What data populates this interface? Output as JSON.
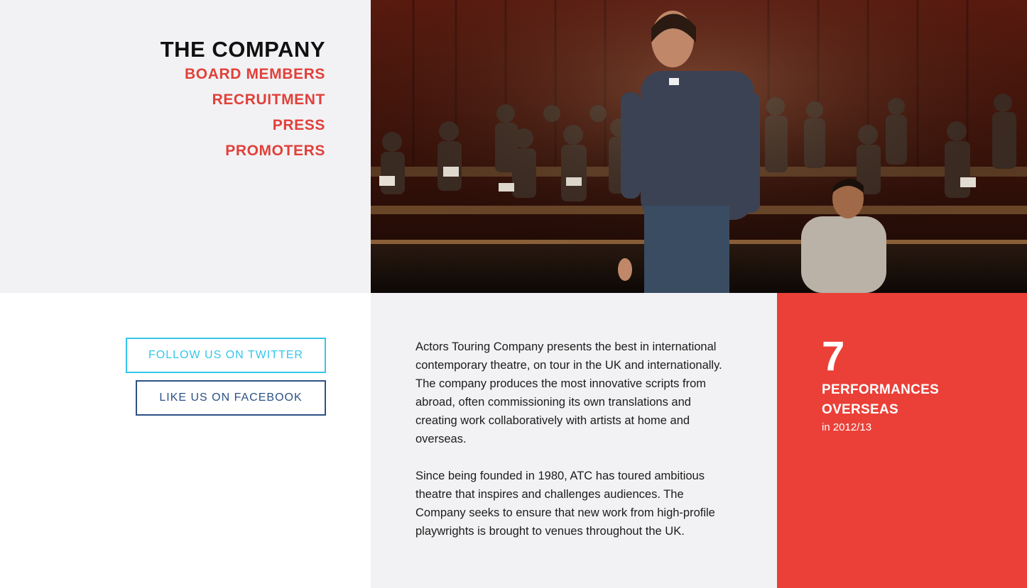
{
  "nav": {
    "title": "THE COMPANY",
    "links": [
      "BOARD MEMBERS",
      "RECRUITMENT",
      "PRESS",
      "PROMOTERS"
    ]
  },
  "hero": {
    "image": "theatre-performance-photo"
  },
  "social": {
    "twitter_label": "FOLLOW US ON TWITTER",
    "facebook_label": "LIKE US ON FACEBOOK"
  },
  "about": {
    "paragraphs": [
      "Actors Touring Company presents the best in international contemporary theatre, on tour in the UK and internationally. The company produces the most innovative scripts from abroad, often commissioning its own translations and creating work collaboratively with artists at home and overseas.",
      "Since being founded in 1980, ATC has toured ambitious theatre that inspires and challenges audiences. The Company seeks to ensure that new work from high-profile playwrights is brought to venues throughout the UK."
    ]
  },
  "stat": {
    "number": "7",
    "label": "PERFORMANCES OVERSEAS",
    "sub": "in 2012/13"
  },
  "colors": {
    "accent_red": "#e0413a",
    "stat_bg": "#ea4038",
    "twitter": "#35c6ea",
    "facebook": "#2e5186",
    "panel_grey": "#f2f2f4"
  }
}
